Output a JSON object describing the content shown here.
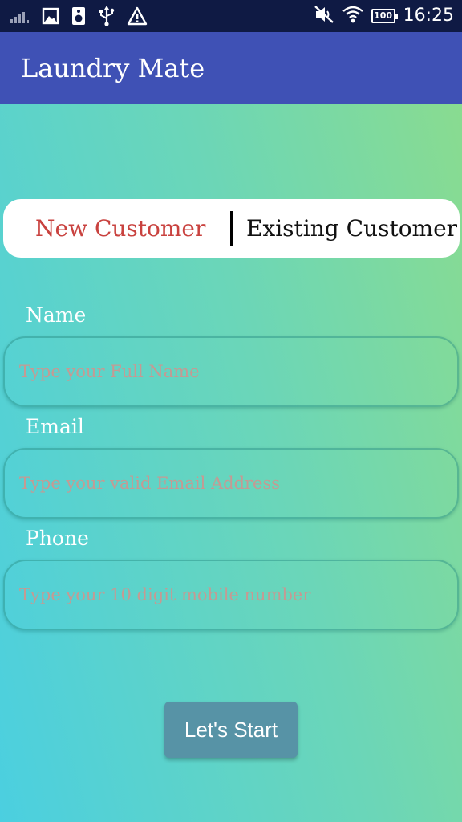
{
  "status_bar": {
    "time": "16:25",
    "battery": "100",
    "icons": [
      "signal-icon",
      "image-icon",
      "speaker-icon",
      "usb-icon",
      "warning-icon",
      "mute-icon",
      "wifi-icon",
      "battery-icon"
    ]
  },
  "app_bar": {
    "title": "Laundry Mate",
    "color": "#3f51b5"
  },
  "toggle": {
    "new_customer": "New Customer",
    "existing_customer": "Existing Customer",
    "selected": "New Customer",
    "selected_color": "#c9423f"
  },
  "form": {
    "name": {
      "label": "Name",
      "placeholder": "Type your Full Name",
      "value": ""
    },
    "email": {
      "label": "Email",
      "placeholder": "Type your valid Email Address",
      "value": ""
    },
    "phone": {
      "label": "Phone",
      "placeholder": "Type your 10 digit mobile number",
      "value": ""
    }
  },
  "start_button": {
    "label": "Let's Start",
    "color": "#5793a6"
  }
}
